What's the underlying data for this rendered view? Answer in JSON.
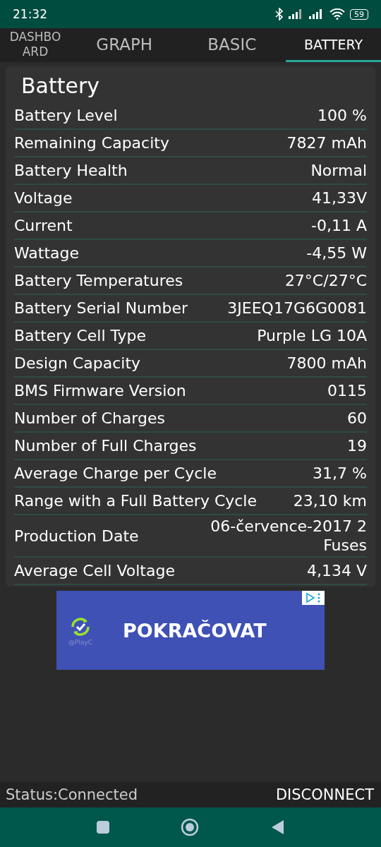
{
  "status_bar": {
    "time": "21:32",
    "battery": "59"
  },
  "tabs": [
    {
      "label": "DASHBOARD",
      "selected": false
    },
    {
      "label": "GRAPH",
      "selected": false
    },
    {
      "label": "BASIC",
      "selected": false
    },
    {
      "label": "BATTERY",
      "selected": true
    }
  ],
  "card": {
    "title": "Battery",
    "rows": [
      {
        "label": "Battery Level",
        "value": "100 %"
      },
      {
        "label": "Remaining Capacity",
        "value": "7827 mAh"
      },
      {
        "label": "Battery Health",
        "value": "Normal"
      },
      {
        "label": "Voltage",
        "value": "41,33V"
      },
      {
        "label": "Current",
        "value": "-0,11 A"
      },
      {
        "label": "Wattage",
        "value": "-4,55 W"
      },
      {
        "label": "Battery Temperatures",
        "value": "27°C/27°C"
      },
      {
        "label": "Battery Serial Number",
        "value": "3JEEQ17G6G0081"
      },
      {
        "label": "Battery Cell Type",
        "value": "Purple LG 10A"
      },
      {
        "label": "Design Capacity",
        "value": "7800 mAh"
      },
      {
        "label": "BMS Firmware Version",
        "value": "0115"
      },
      {
        "label": "Number of Charges",
        "value": "60"
      },
      {
        "label": "Number of Full Charges",
        "value": "19"
      },
      {
        "label": "Average Charge per Cycle",
        "value": "31,7 %"
      },
      {
        "label": "Range with a Full Battery Cycle",
        "value": "23,10 km"
      },
      {
        "label": "Production Date",
        "value": "06-července-2017 2 Fuses"
      },
      {
        "label": "Average Cell Voltage",
        "value": "4,134 V"
      }
    ]
  },
  "ad": {
    "caption": "@PlayC",
    "button": "POKRAČOVAT"
  },
  "footer": {
    "status": "Status:Connected",
    "button": "DISCONNECT"
  }
}
